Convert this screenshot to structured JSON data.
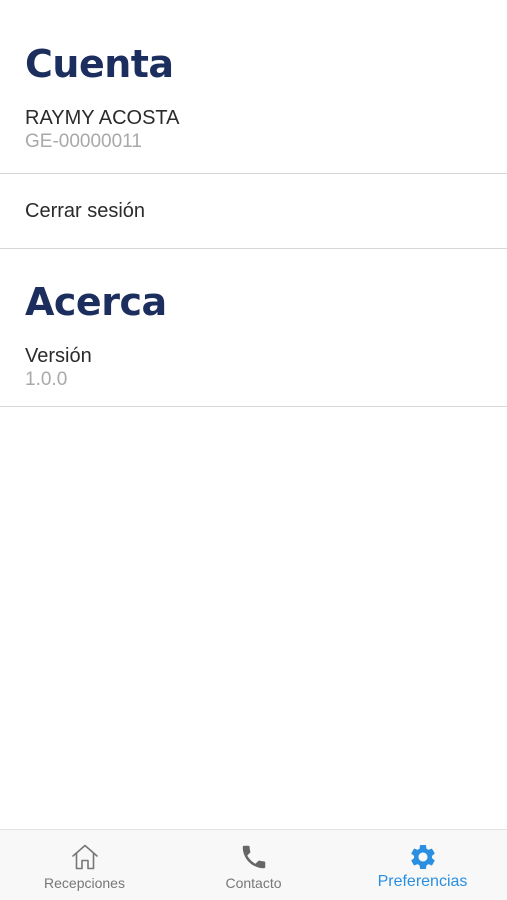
{
  "account": {
    "title": "Cuenta",
    "user_name": "RAYMY ACOSTA",
    "user_id": "GE-00000011",
    "logout_label": "Cerrar sesión"
  },
  "about": {
    "title": "Acerca",
    "version_label": "Versión",
    "version_value": "1.0.0"
  },
  "tabbar": {
    "active_color": "#2a8fe0",
    "inactive_color": "#777777",
    "tabs": [
      {
        "label": "Recepciones",
        "icon": "home-icon",
        "active": false
      },
      {
        "label": "Contacto",
        "icon": "phone-icon",
        "active": false
      },
      {
        "label": "Preferencias",
        "icon": "gear-icon",
        "active": true
      }
    ]
  }
}
